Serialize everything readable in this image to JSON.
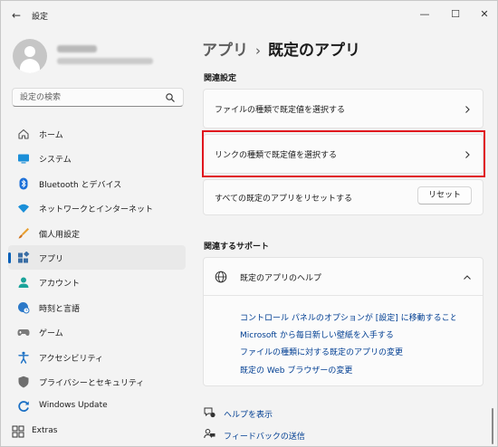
{
  "window": {
    "title": "設定",
    "back_label": "←",
    "minimize_label": "—",
    "maximize_label": "☐",
    "close_label": "✕"
  },
  "search": {
    "placeholder": "設定の検索"
  },
  "sidebar": {
    "items": [
      {
        "label": "ホーム",
        "icon": "home-icon"
      },
      {
        "label": "システム",
        "icon": "system-icon"
      },
      {
        "label": "Bluetooth とデバイス",
        "icon": "bluetooth-icon"
      },
      {
        "label": "ネットワークとインターネット",
        "icon": "wifi-icon"
      },
      {
        "label": "個人用設定",
        "icon": "brush-icon"
      },
      {
        "label": "アプリ",
        "icon": "apps-icon",
        "selected": true
      },
      {
        "label": "アカウント",
        "icon": "account-icon"
      },
      {
        "label": "時刻と言語",
        "icon": "globe-clock-icon"
      },
      {
        "label": "ゲーム",
        "icon": "gamepad-icon"
      },
      {
        "label": "アクセシビリティ",
        "icon": "accessibility-icon"
      },
      {
        "label": "プライバシーとセキュリティ",
        "icon": "shield-icon"
      },
      {
        "label": "Windows Update",
        "icon": "windows-update-icon"
      }
    ],
    "extras": {
      "label": "Extras",
      "icon": "extras-icon"
    }
  },
  "main": {
    "breadcrumb": {
      "parent": "アプリ",
      "separator": "›",
      "current": "既定のアプリ"
    },
    "related_settings": {
      "heading": "関連設定",
      "rows": [
        {
          "label": "ファイルの種類で既定値を選択する"
        },
        {
          "label": "リンクの種類で既定値を選択する"
        },
        {
          "label": "すべての既定のアプリをリセットする",
          "button": "リセット"
        }
      ]
    },
    "related_support": {
      "heading": "関連するサポート",
      "help_title": "既定のアプリのヘルプ",
      "links": [
        "コントロール パネルのオプションが [設定] に移動することについて",
        "Microsoft から毎日新しい壁紙を入手する",
        "ファイルの種類に対する既定のアプリの変更",
        "既定の Web ブラウザーの変更"
      ]
    },
    "footer": {
      "get_help": "ヘルプを表示",
      "feedback": "フィードバックの送信"
    }
  },
  "colors": {
    "accent": "#005fb8",
    "link": "#003e92",
    "highlight_border": "#e0141e",
    "background": "#f3f3f3",
    "card": "#fbfbfb"
  }
}
